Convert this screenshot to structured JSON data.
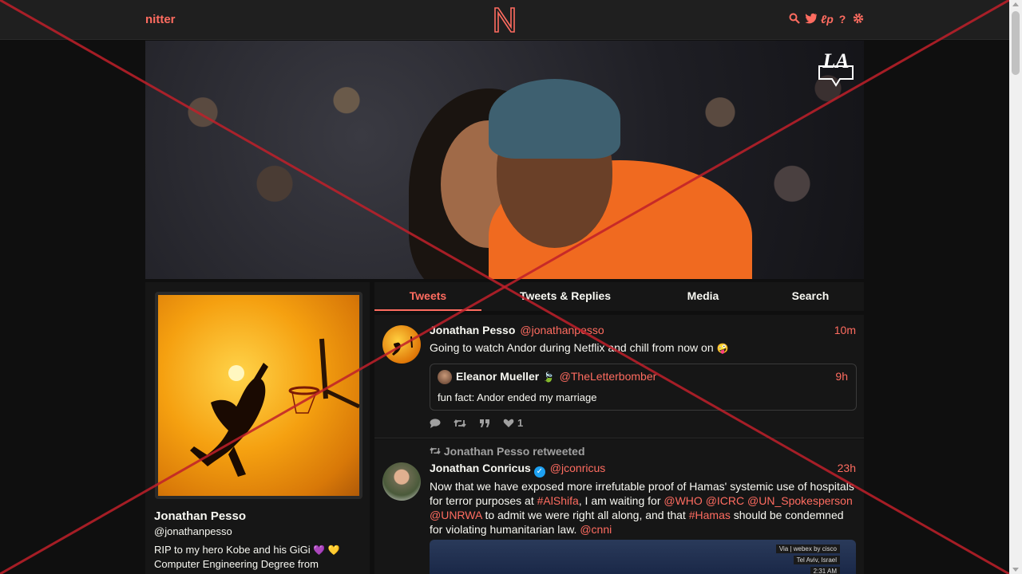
{
  "nav": {
    "brand": "nitter",
    "logo_letter": "N",
    "icons": [
      "search-icon",
      "twitter-bird-icon",
      "liberapay-icon",
      "help-icon",
      "settings-gear-icon"
    ],
    "accent": "#ff6c60"
  },
  "profile": {
    "name": "Jonathan Pesso",
    "handle": "@jonathanpesso",
    "bio_line1": "RIP to my hero Kobe and his GiGi",
    "bio_emoji": "💜 💛",
    "bio_line2": "Computer Engineering Degree from"
  },
  "tabs": [
    {
      "label": "Tweets",
      "active": true
    },
    {
      "label": "Tweets & Replies",
      "active": false
    },
    {
      "label": "Media",
      "active": false
    },
    {
      "label": "Search",
      "active": false
    }
  ],
  "tweets": [
    {
      "name": "Jonathan Pesso",
      "handle": "@jonathanpesso",
      "time": "10m",
      "text": "Going to watch Andor during Netflix and chill from now on",
      "emoji": "🤪",
      "quote": {
        "name": "Eleanor Mueller",
        "name_emoji": "🍃",
        "handle": "@TheLetterbomber",
        "time": "9h",
        "text": "fun fact: Andor ended my marriage"
      },
      "stats": {
        "replies": "",
        "retweets": "",
        "quotes": "",
        "likes": "1"
      }
    },
    {
      "retweeted_by": "Jonathan Pesso retweeted",
      "name": "Jonathan Conricus",
      "verified_mark": "✓",
      "handle": "@jconricus",
      "time": "23h",
      "text_parts": {
        "p1": "Now that we have exposed more irrefutable proof of Hamas' systemic use of hospitals for terror purposes at ",
        "alshifa": "#AlShifa",
        "p2": ", I am waiting for ",
        "who": "@WHO",
        "icrc": "@ICRC",
        "un": "@UN_Spokesperson",
        "unrwa": "@UNRWA",
        "p3": " to admit we were right all along, and that ",
        "hamas": "#Hamas",
        "p4": " should be condemned for violating humanitarian law. ",
        "cnni": "@cnni"
      },
      "media_caption": {
        "via": "Via | webex by cisco",
        "location": "Tel Aviv, Israel",
        "time": "2:31 AM"
      }
    }
  ]
}
